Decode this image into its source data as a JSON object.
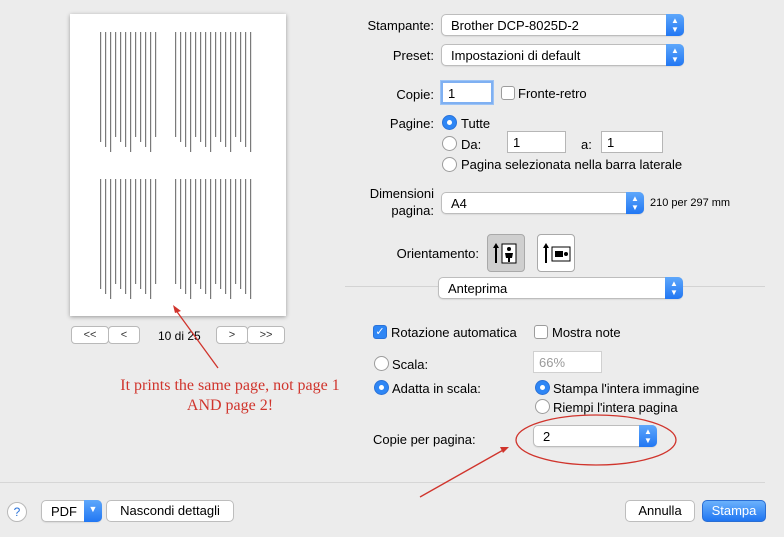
{
  "preview": {
    "page_indicator": "10 di 25",
    "nav": {
      "first": "<<",
      "prev": "<",
      "next": ">",
      "last": ">>"
    }
  },
  "printer": {
    "label": "Stampante:",
    "value": "Brother DCP-8025D-2"
  },
  "preset": {
    "label": "Preset:",
    "value": "Impostazioni di default"
  },
  "copies": {
    "label": "Copie:",
    "value": "1",
    "duplex_label": "Fronte-retro",
    "duplex_checked": false
  },
  "pages": {
    "label": "Pagine:",
    "all_label": "Tutte",
    "from_label": "Da:",
    "from_value": "1",
    "to_label": "a:",
    "to_value": "1",
    "selected_label": "Pagina selezionata nella barra laterale",
    "selected_option": "all"
  },
  "paper_size": {
    "label_line1": "Dimensioni",
    "label_line2": "pagina:",
    "value": "A4",
    "dims": "210 per 297 mm"
  },
  "orientation": {
    "label": "Orientamento:",
    "selected": "portrait"
  },
  "section_popup": {
    "value": "Anteprima"
  },
  "options": {
    "auto_rotate_label": "Rotazione automatica",
    "auto_rotate_checked": true,
    "show_notes_label": "Mostra note",
    "show_notes_checked": false
  },
  "scale": {
    "scale_label": "Scala:",
    "scale_value": "66%",
    "fit_label": "Adatta in scala:",
    "fit_selected": true,
    "print_whole_label": "Stampa l'intera immagine",
    "fill_page_label": "Riempi l'intera pagina",
    "fit_mode": "print_whole"
  },
  "copies_per_page": {
    "label": "Copie per pagina:",
    "value": "2"
  },
  "footer": {
    "help": "?",
    "pdf_label": "PDF",
    "hide_details_label": "Nascondi dettagli",
    "cancel_label": "Annulla",
    "print_label": "Stampa"
  },
  "annotation": {
    "line1": "It prints the same page, not page 1",
    "line2": "AND page 2!",
    "color": "#d0342c"
  },
  "colors": {
    "accent": "#2e86f5",
    "annotation": "#d0342c"
  }
}
